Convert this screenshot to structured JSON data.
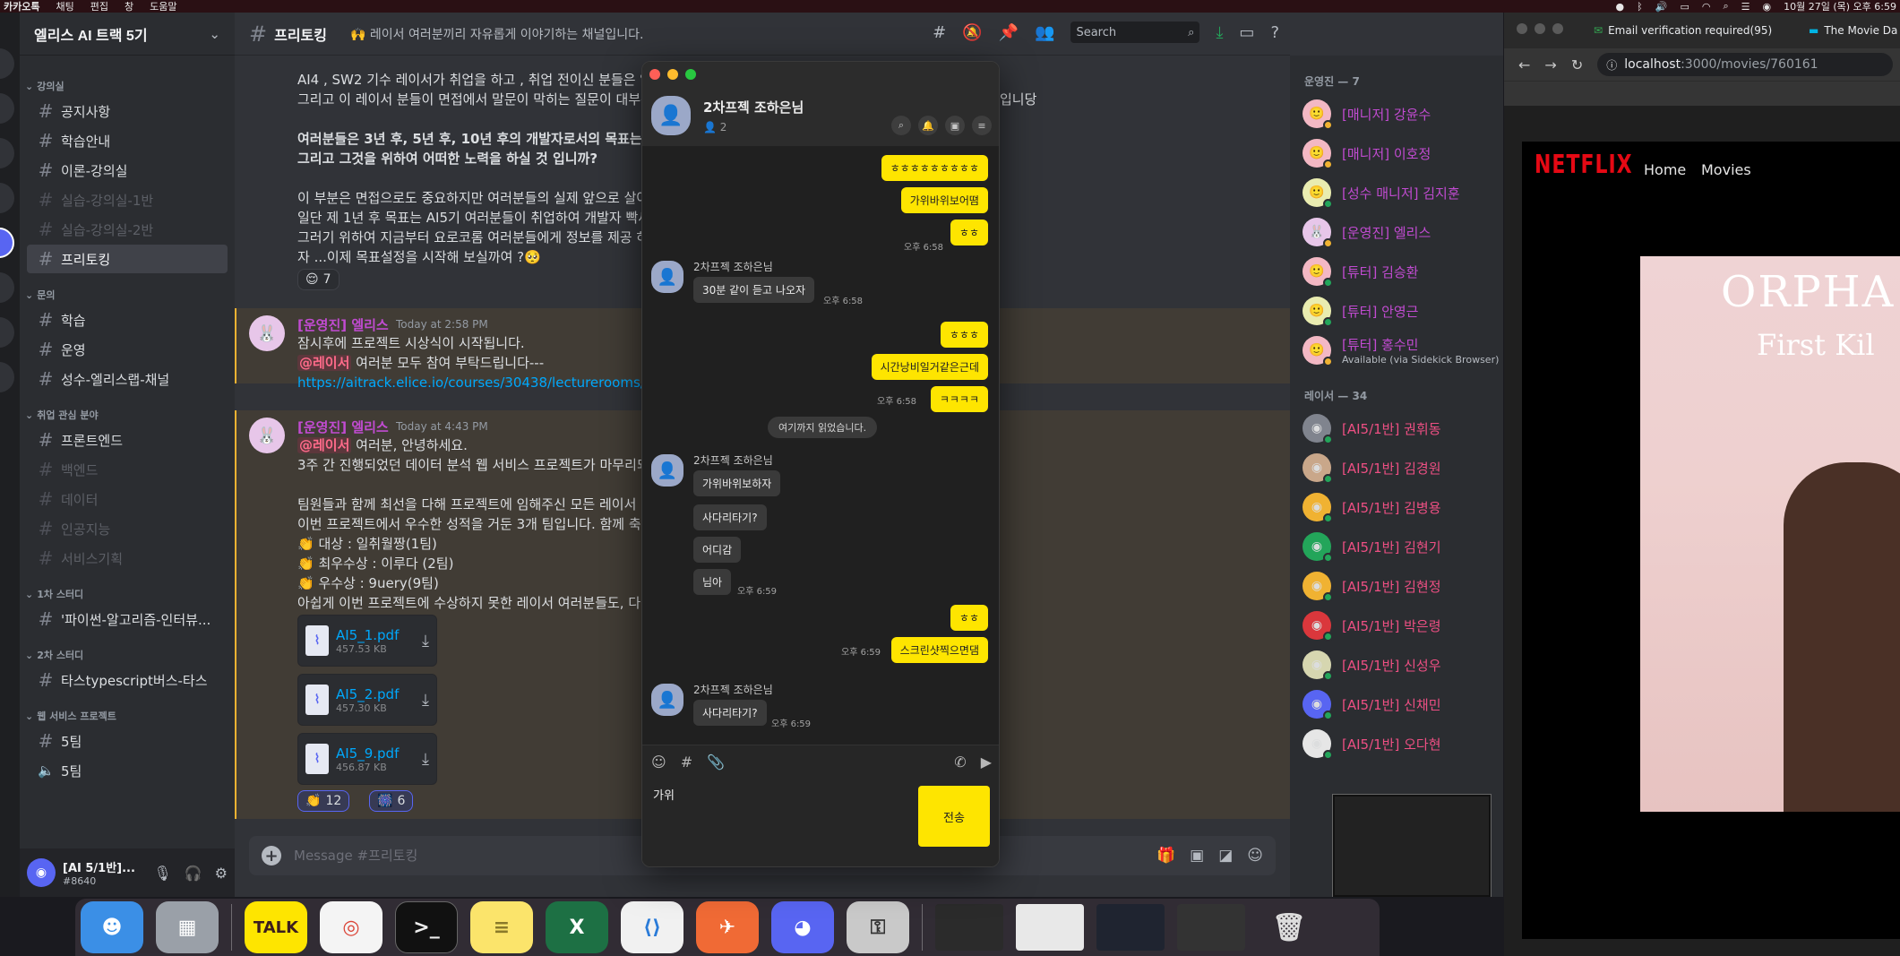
{
  "menubar": {
    "app": "카카오톡",
    "menus": [
      "채팅",
      "편집",
      "창",
      "도움말"
    ],
    "clock": "10월 27일 (목) 오후 6:59"
  },
  "discord": {
    "server_name": "엘리스 AI 트랙 5기",
    "categories": {
      "lecture": "강의실",
      "questions": "문의",
      "jobs": "취업 관심 분야",
      "study1": "1차 스터디",
      "study2": "2차 스터디",
      "web": "웹 서비스 프로젝트"
    },
    "channels": {
      "notice": "공지사항",
      "guide": "학습안내",
      "theory": "이론-강의실",
      "lab1": "실습-강의실-1반",
      "lab2": "실습-강의실-2반",
      "freetalk": "프리토킹",
      "study": "학습",
      "ops": "운영",
      "elice_lab": "성수-엘리스랩-채널",
      "frontend": "프론트엔드",
      "backend": "백엔드",
      "data": "데이터",
      "ai": "인공지능",
      "service": "서비스기획",
      "python": "'파이썬-알고리즘-인터뷰...",
      "ts": "타스typescript버스-타스",
      "team5": "5팀",
      "team5voice": "5팀"
    },
    "user": {
      "name": "[AI 5/1반]...",
      "tag": "#8640"
    },
    "chat": {
      "title": "프리토킹",
      "topic": "🙌 레이서 여러분끼리 자유롭게 이야기하는 채널입니다.",
      "search_placeholder": "Search",
      "composer_placeholder": "Message #프리토킹",
      "lines_top": [
        "AI4 , SW2 기수 레이서가 취업을 하고 , 취업 전이신 분들은 열",
        "그리고 이 레이서 분들이 면접에서 말문이 막히는 질문이 대부분",
        "입니당",
        "여러분들은 3년 후, 5년 후, 10년 후의 개발자로서의 목표는 무엇",
        "그리고 그것을 위하여 어떠한 노력을 하실 것 입니까?",
        "이 부분은 면접으로도 중요하지만 여러분들의 실제 앞으로 살아",
        "일단 제 1년 후 목표는 AI5기 여러분들이 취업하여 개발자 빡세",
        "그러기 위하여 지금부터 요로코롬 여러분들에게 정보를 제공 하",
        "자 ...이제 목표설정을 시작해 보실까여 ?🥺"
      ],
      "reaction1": {
        "emoji": "😌",
        "count": "7"
      },
      "msg2": {
        "author": "[운영진] 엘리스",
        "time": "Today at 2:58 PM",
        "line1": "잠시후에 프로젝트 시상식이 시작됩니다.",
        "mention": "@레이서",
        "line2": " 여러분 모두 참여 부탁드립니다---",
        "link": "https://aitrack.elice.io/courses/30438/lecturerooms/344"
      },
      "msg3": {
        "author": "[운영진] 엘리스",
        "time": "Today at 4:43 PM",
        "mention": "@레이서",
        "line1": " 여러분, 안녕하세요.",
        "line2": "3주 간 진행되었던 데이터 분석 웹 서비스 프로젝트가 마무리되",
        "line3": "팀원들과 함께 최선을 다해 프로젝트에 임해주신 모든 레이서 여",
        "line4": "이번 프로젝트에서 우수한 성적을 거둔 3개 팀입니다. 함께 축하",
        "award1": "👏 대상 : 일취월짱(1팀)",
        "award2": "👏 최우수상 : 이루다 (2팀)",
        "award3": "👏 우수상 : 9uery(9팀)",
        "line5": "아쉽게 이번 프로젝트에 수상하지 못한 레이서 여러분들도, 다"
      },
      "files": [
        {
          "name": "AI5_1.pdf",
          "size": "457.53 KB"
        },
        {
          "name": "AI5_2.pdf",
          "size": "457.30 KB"
        },
        {
          "name": "AI5_9.pdf",
          "size": "456.87 KB"
        }
      ],
      "reaction2": {
        "emoji": "👏",
        "count": "12"
      },
      "reaction3": {
        "emoji": "🎆",
        "count": "6"
      }
    },
    "members": {
      "staff_header": "운영진 — 7",
      "staff": [
        {
          "name": "[매니저] 강윤수"
        },
        {
          "name": "[매니저] 이호정"
        },
        {
          "name": "[성수 매니저] 김지훈"
        },
        {
          "name": "[운영진] 엘리스"
        },
        {
          "name": "[튜터] 김승환"
        },
        {
          "name": "[튜터] 안영근"
        },
        {
          "name": "[튜터] 홍수민",
          "sub": "Available (via Sidekick Browser)"
        }
      ],
      "racer_header": "레이서 — 34",
      "racers": [
        "[AI5/1반] 권휘동",
        "[AI5/1반] 김경원",
        "[AI5/1반] 김병용",
        "[AI5/1반] 김현기",
        "[AI5/1반] 김현정",
        "[AI5/1반] 박은령",
        "[AI5/1반] 신성우",
        "[AI5/1반] 신채민",
        "[AI5/1반] 오다현"
      ]
    }
  },
  "kakao": {
    "title": "2차프젝 조하은님",
    "member_count": "2",
    "messages": {
      "m1": "ㅎㅎㅎㅎㅎㅎㅎㅎㅎ",
      "m2": "가위바위보어뗨",
      "m3": "ㅎㅎ",
      "t1": "오후 6:58",
      "sender": "2차프젝 조하은님",
      "o1": "30분 같이 듣고 나오자",
      "t2": "오후 6:58",
      "m4": "ㅎㅎㅎ",
      "m5": "시간낭비일거같은근데",
      "t3": "오후 6:58",
      "m6": "ㅋㅋㅋㅋ",
      "read_marker": "여기까지 읽었습니다.",
      "o2": "가위바위보하자",
      "o3": "사다리타기?",
      "o4": "어디감",
      "o5": "님아",
      "t4": "오후 6:59",
      "m7": "ㅎㅎ",
      "t5": "오후 6:59",
      "m8": "스크린샷찍으면댐",
      "o6": "사다리타기?",
      "t6": "오후 6:59"
    },
    "input_value": "가위",
    "send_label": "전송"
  },
  "chrome": {
    "tab1": "Email verification required(95)",
    "tab2": "The Movie Da",
    "url_host": "localhost",
    "url_path": ":3000/movies/760161",
    "netflix_logo": "NETFLIX",
    "nav_home": "Home",
    "nav_movies": "Movies",
    "poster_title": "ORPHA",
    "poster_subtitle": "First Kil"
  },
  "dock": {
    "talk_label": "TALK"
  },
  "colors": {
    "discord_bg": "#313338",
    "kakao_yellow": "#fee500",
    "netflix_red": "#e50914",
    "mention": "#ff6b8a",
    "staff_name": "#c14bd1",
    "racer_name": "#ed4f83"
  }
}
